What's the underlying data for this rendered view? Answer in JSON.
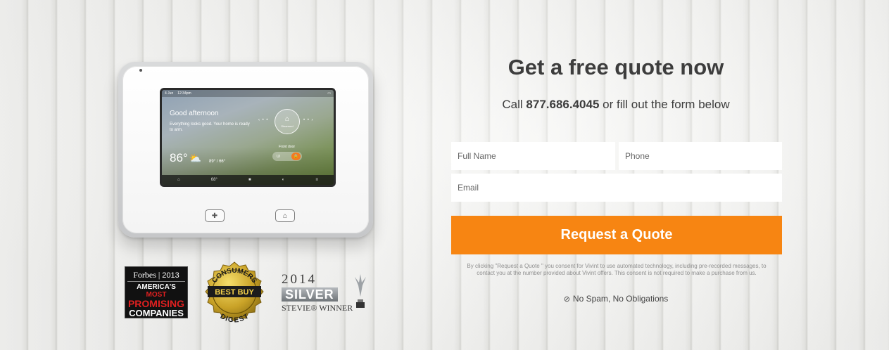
{
  "panel": {
    "status_date": "4 Jun",
    "status_time": "12:34pm",
    "greeting": "Good afternoon",
    "message": "Everything looks good. Your home is ready to arm.",
    "temperature": "86°",
    "temp_range_high": "89°",
    "temp_range_sep": "/",
    "temp_range_low": "66°",
    "arm_label": "Disarmed",
    "front_door_label": "Front door",
    "toggle_left": "Ul",
    "nav_temp": "68°"
  },
  "badges": {
    "forbes_brand": "Forbes",
    "forbes_year": "2013",
    "forbes_line1_a": "AMERICA'S",
    "forbes_line1_b": "MOST",
    "forbes_line2": "PROMISING",
    "forbes_line3": "COMPANIES",
    "cd_top": "CONSUMERS",
    "cd_middle": "BEST BUY",
    "cd_bottom": "DIGEST",
    "stevie_year": "2014",
    "stevie_silver": "SILVER",
    "stevie_winner": "STEVIE® WINNER"
  },
  "form": {
    "headline": "Get a free quote now",
    "call_prefix": "Call",
    "phone_number": "877.686.4045",
    "call_suffix": "or fill out the form below",
    "full_name_placeholder": "Full Name",
    "phone_placeholder": "Phone",
    "email_placeholder": "Email",
    "submit_label": "Request a Quote",
    "consent_text": "By clicking \"Request a Quote \" you consent for Vivint to use automated technology, including pre-recorded messages, to contact you at the number provided about Vivint offers. This consent is not required to make a purchase from us.",
    "no_spam_label": "No Spam, No Obligations"
  },
  "colors": {
    "accent": "#f78512",
    "text": "#3d3d3d"
  }
}
